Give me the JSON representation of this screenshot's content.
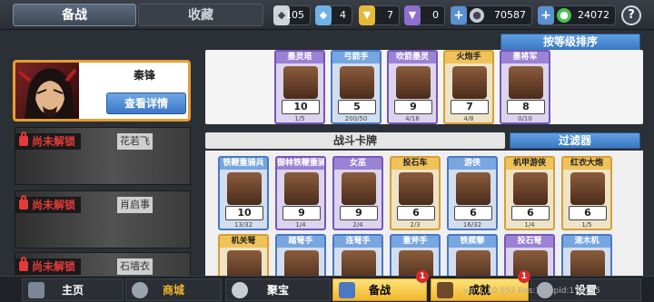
{
  "tabs": {
    "active": "备战",
    "inactive": "收藏"
  },
  "resources": [
    {
      "name": "silver-gem",
      "value": "105",
      "color": "#d9dde3"
    },
    {
      "name": "blue-crystal",
      "value": "4",
      "color": "#6fb2e6"
    },
    {
      "name": "gold-badge",
      "value": "7",
      "color": "#e6b93b"
    },
    {
      "name": "purple-badge",
      "value": "0",
      "color": "#8e6fd0"
    },
    {
      "name": "silver-coin",
      "value": "70587",
      "color": "#c7ccd2"
    },
    {
      "name": "green-coin",
      "value": "24072",
      "color": "#4cc34c"
    }
  ],
  "help_label": "?",
  "hero": {
    "name": "秦锋",
    "detail_button": "查看详情"
  },
  "locked_heroes": [
    {
      "status": "尚未解锁",
      "name": "花若飞"
    },
    {
      "status": "尚未解锁",
      "name": "肖启事"
    },
    {
      "status": "尚未解锁",
      "name": "石墙衣"
    }
  ],
  "sort_button": "按等级排序",
  "top_cards": [
    {
      "title": "墨灵塔",
      "level": "10",
      "count": "1/5",
      "rarity": "purple"
    },
    {
      "title": "弓箭手",
      "level": "5",
      "count": "200/50",
      "rarity": "blue"
    },
    {
      "title": "吹箭墨灵",
      "level": "9",
      "count": "4/16",
      "rarity": "purple"
    },
    {
      "title": "火炮手",
      "level": "7",
      "count": "4/8",
      "rarity": "gold"
    },
    {
      "title": "墨将军",
      "level": "8",
      "count": "0/10",
      "rarity": "purple"
    }
  ],
  "section_title": "战斗卡牌",
  "filter_button": "过滤器",
  "battle_cards": [
    {
      "title": "铁鞭重骑兵",
      "level": "10",
      "count": "13/32",
      "rarity": "blue"
    },
    {
      "title": "御林铁鞭重骑兵",
      "level": "9",
      "count": "1/4",
      "rarity": "purple"
    },
    {
      "title": "女巫",
      "level": "9",
      "count": "2/4",
      "rarity": "purple"
    },
    {
      "title": "投石车",
      "level": "6",
      "count": "2/3",
      "rarity": "gold"
    },
    {
      "title": "游侠",
      "level": "6",
      "count": "16/32",
      "rarity": "blue"
    },
    {
      "title": "机甲游侠",
      "level": "6",
      "count": "1/4",
      "rarity": "gold"
    },
    {
      "title": "红衣大炮",
      "level": "6",
      "count": "1/5",
      "rarity": "gold"
    }
  ],
  "battle_cards_row2": [
    {
      "title": "机关弩",
      "rarity": "gold"
    },
    {
      "title": "踏弩手",
      "rarity": "blue"
    },
    {
      "title": "连弩手",
      "rarity": "blue"
    },
    {
      "title": "重斧手",
      "rarity": "blue"
    },
    {
      "title": "铁蒺藜",
      "rarity": "blue"
    },
    {
      "title": "投石弩",
      "rarity": "purple"
    },
    {
      "title": "滚木机",
      "rarity": "blue"
    }
  ],
  "nav": [
    {
      "label": "主页"
    },
    {
      "label": "商城"
    },
    {
      "label": "聚宝"
    },
    {
      "label": "备战",
      "badge": "1"
    },
    {
      "label": "成就",
      "badge": "1"
    },
    {
      "label": "设置"
    }
  ],
  "debug_text": "ver 1.10.552 Res:188 pid:178155"
}
